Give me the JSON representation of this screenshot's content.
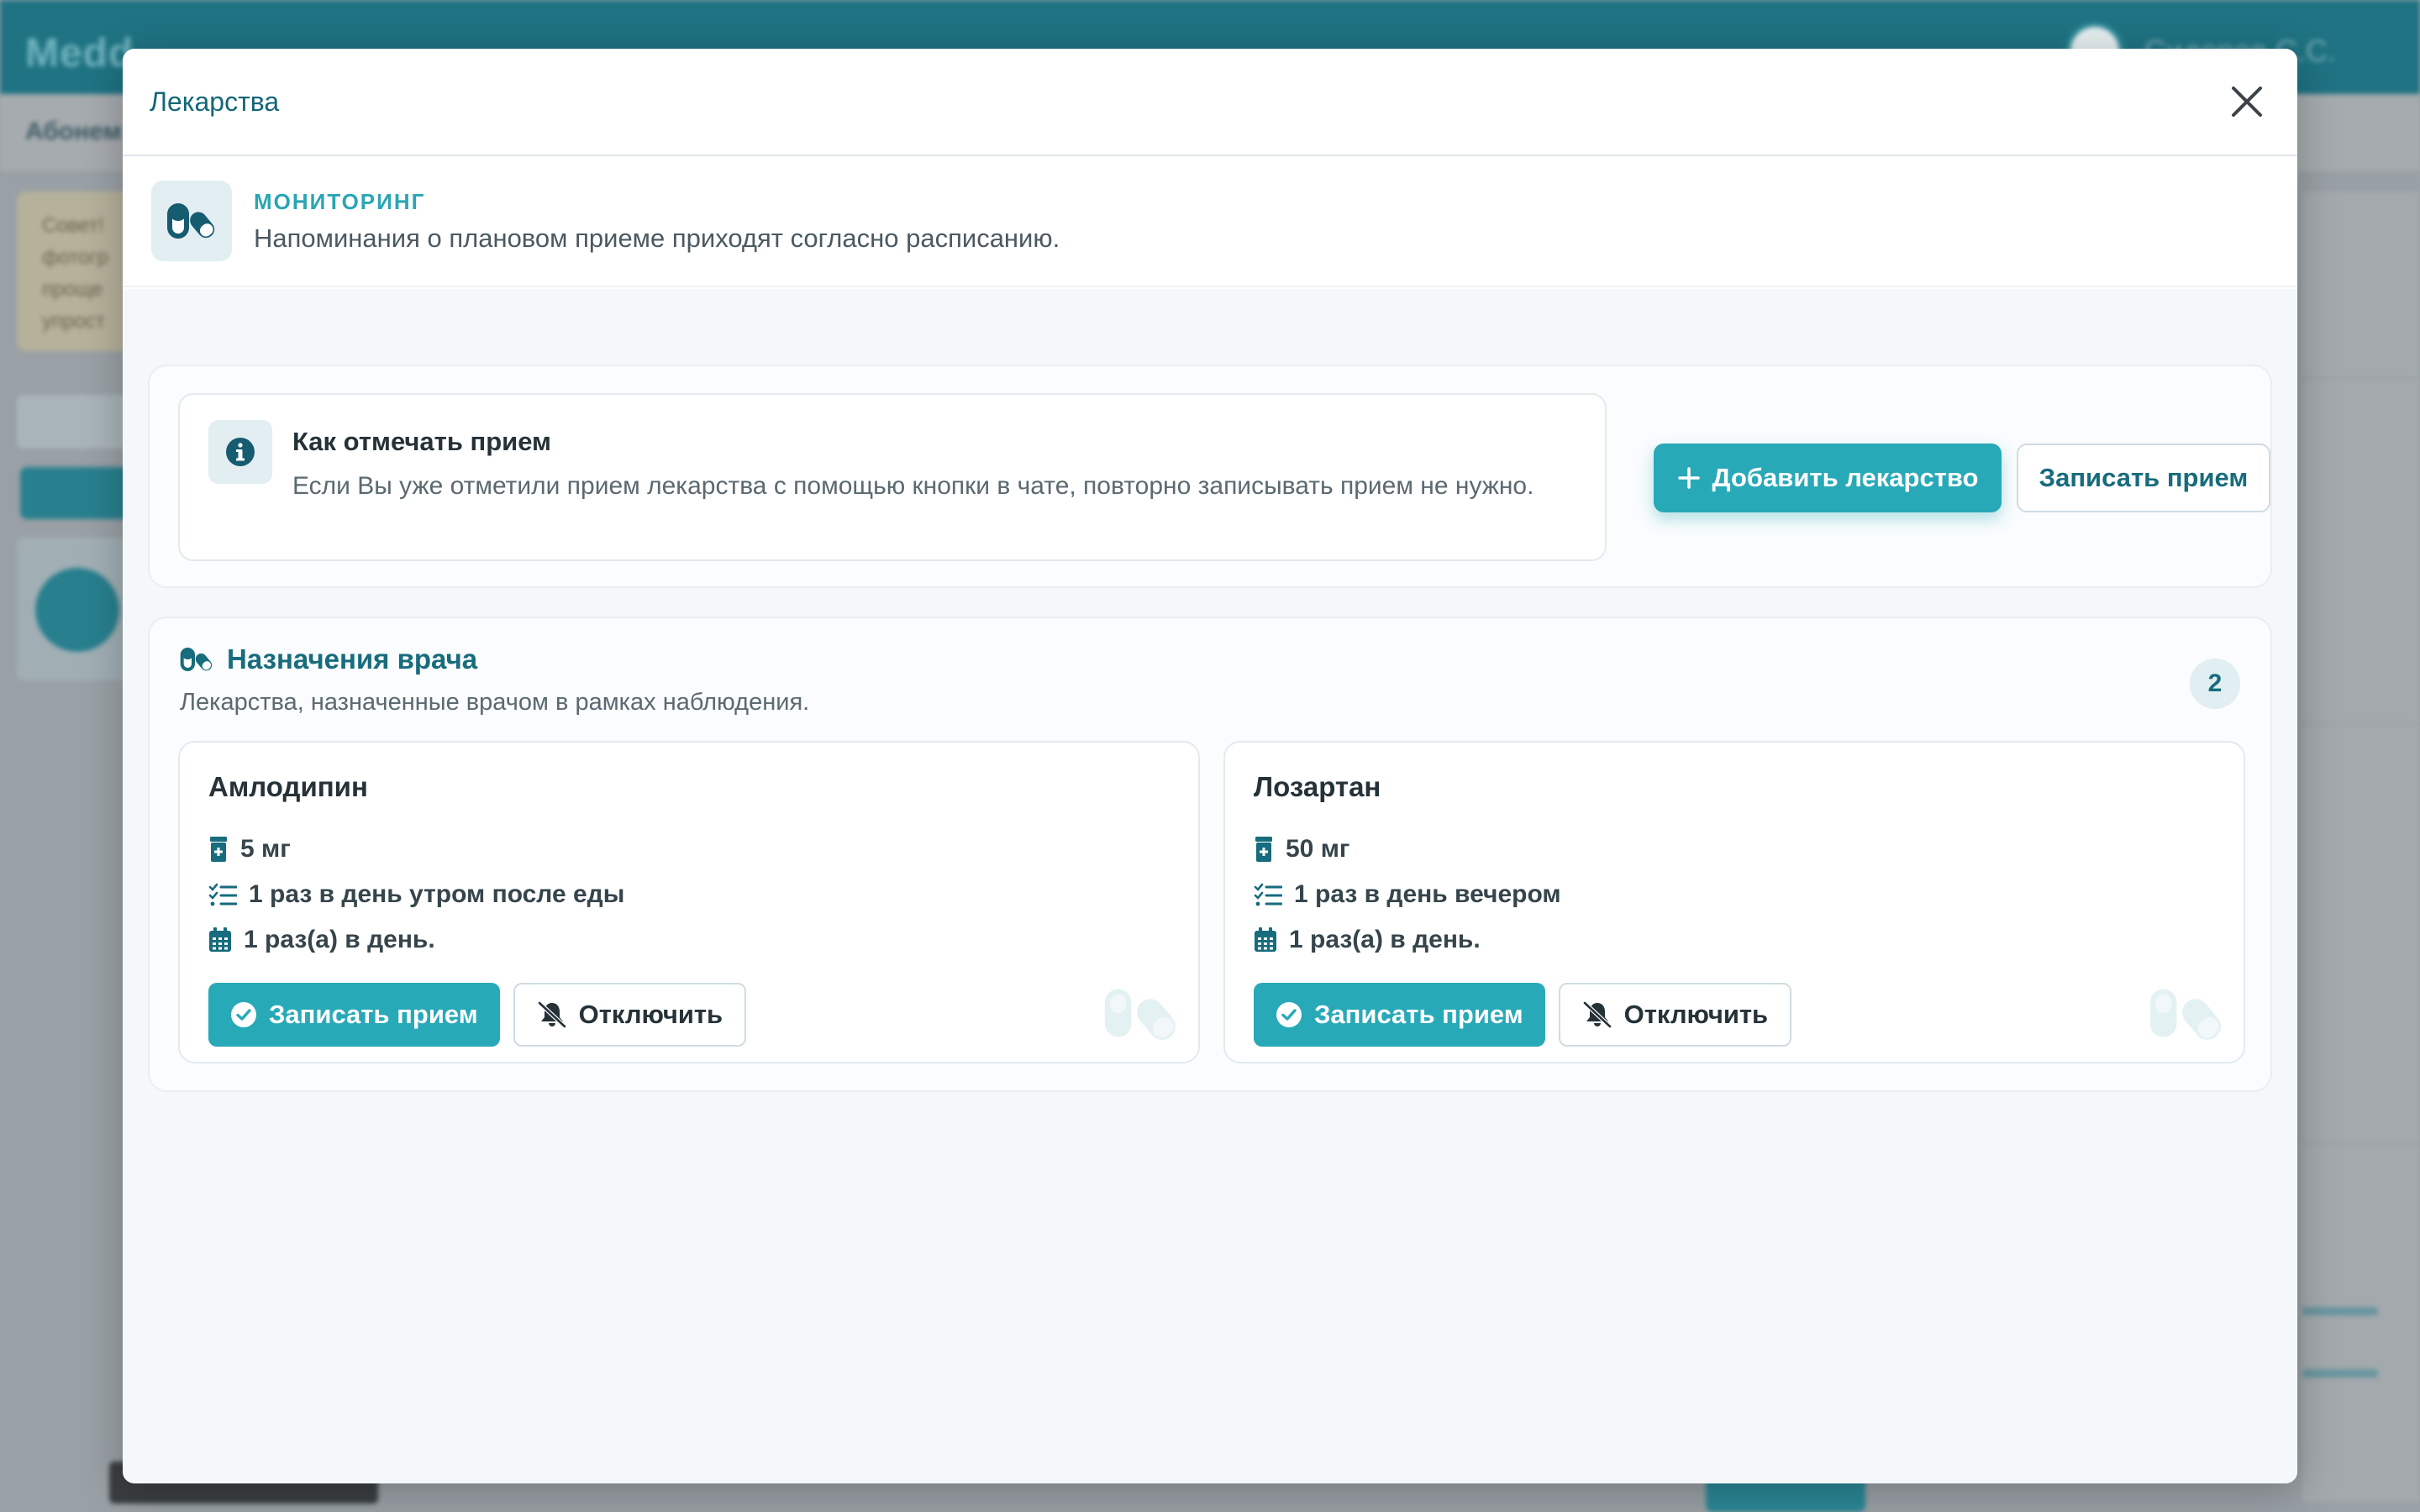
{
  "background": {
    "app_name": "Medd",
    "user_name": "Сидоров С.С.",
    "subtitle": "Абонем",
    "tip": "Совет! фотогр проще упрост"
  },
  "modal": {
    "title": "Лекарства",
    "banner": {
      "label": "МОНИТОРИНГ",
      "description": "Напоминания о плановом приеме приходят согласно расписанию."
    },
    "info": {
      "title": "Как отмечать прием",
      "text": "Если Вы уже отметили прием лекарства с помощью кнопки в чате, повторно записывать прием не нужно.",
      "add_button": "Добавить лекарство",
      "record_button": "Записать прием"
    },
    "prescriptions": {
      "title": "Назначения врача",
      "subtitle": "Лекарства, назначенные врачом в рамках наблюдения.",
      "count": "2",
      "items": [
        {
          "name": "Амлодипин",
          "dose": "5 мг",
          "schedule": "1 раз в день утром после еды",
          "frequency": "1 раз(а) в день.",
          "record_label": "Записать прием",
          "disable_label": "Отключить"
        },
        {
          "name": "Лозартан",
          "dose": "50 мг",
          "schedule": "1 раз в день вечером",
          "frequency": "1 раз(а) в день.",
          "record_label": "Записать прием",
          "disable_label": "Отключить"
        }
      ]
    }
  },
  "colors": {
    "accent": "#28a9b8",
    "primary_text": "#176c7d",
    "topbar": "#1f7383"
  },
  "icons": {
    "close": "close-icon",
    "pills": "pills-icon",
    "info": "info-icon",
    "plus": "plus-icon",
    "bottle": "pill-bottle-icon",
    "list": "list-check-icon",
    "calendar": "calendar-icon",
    "check": "check-circle-icon",
    "bell_off": "bell-slash-icon"
  }
}
